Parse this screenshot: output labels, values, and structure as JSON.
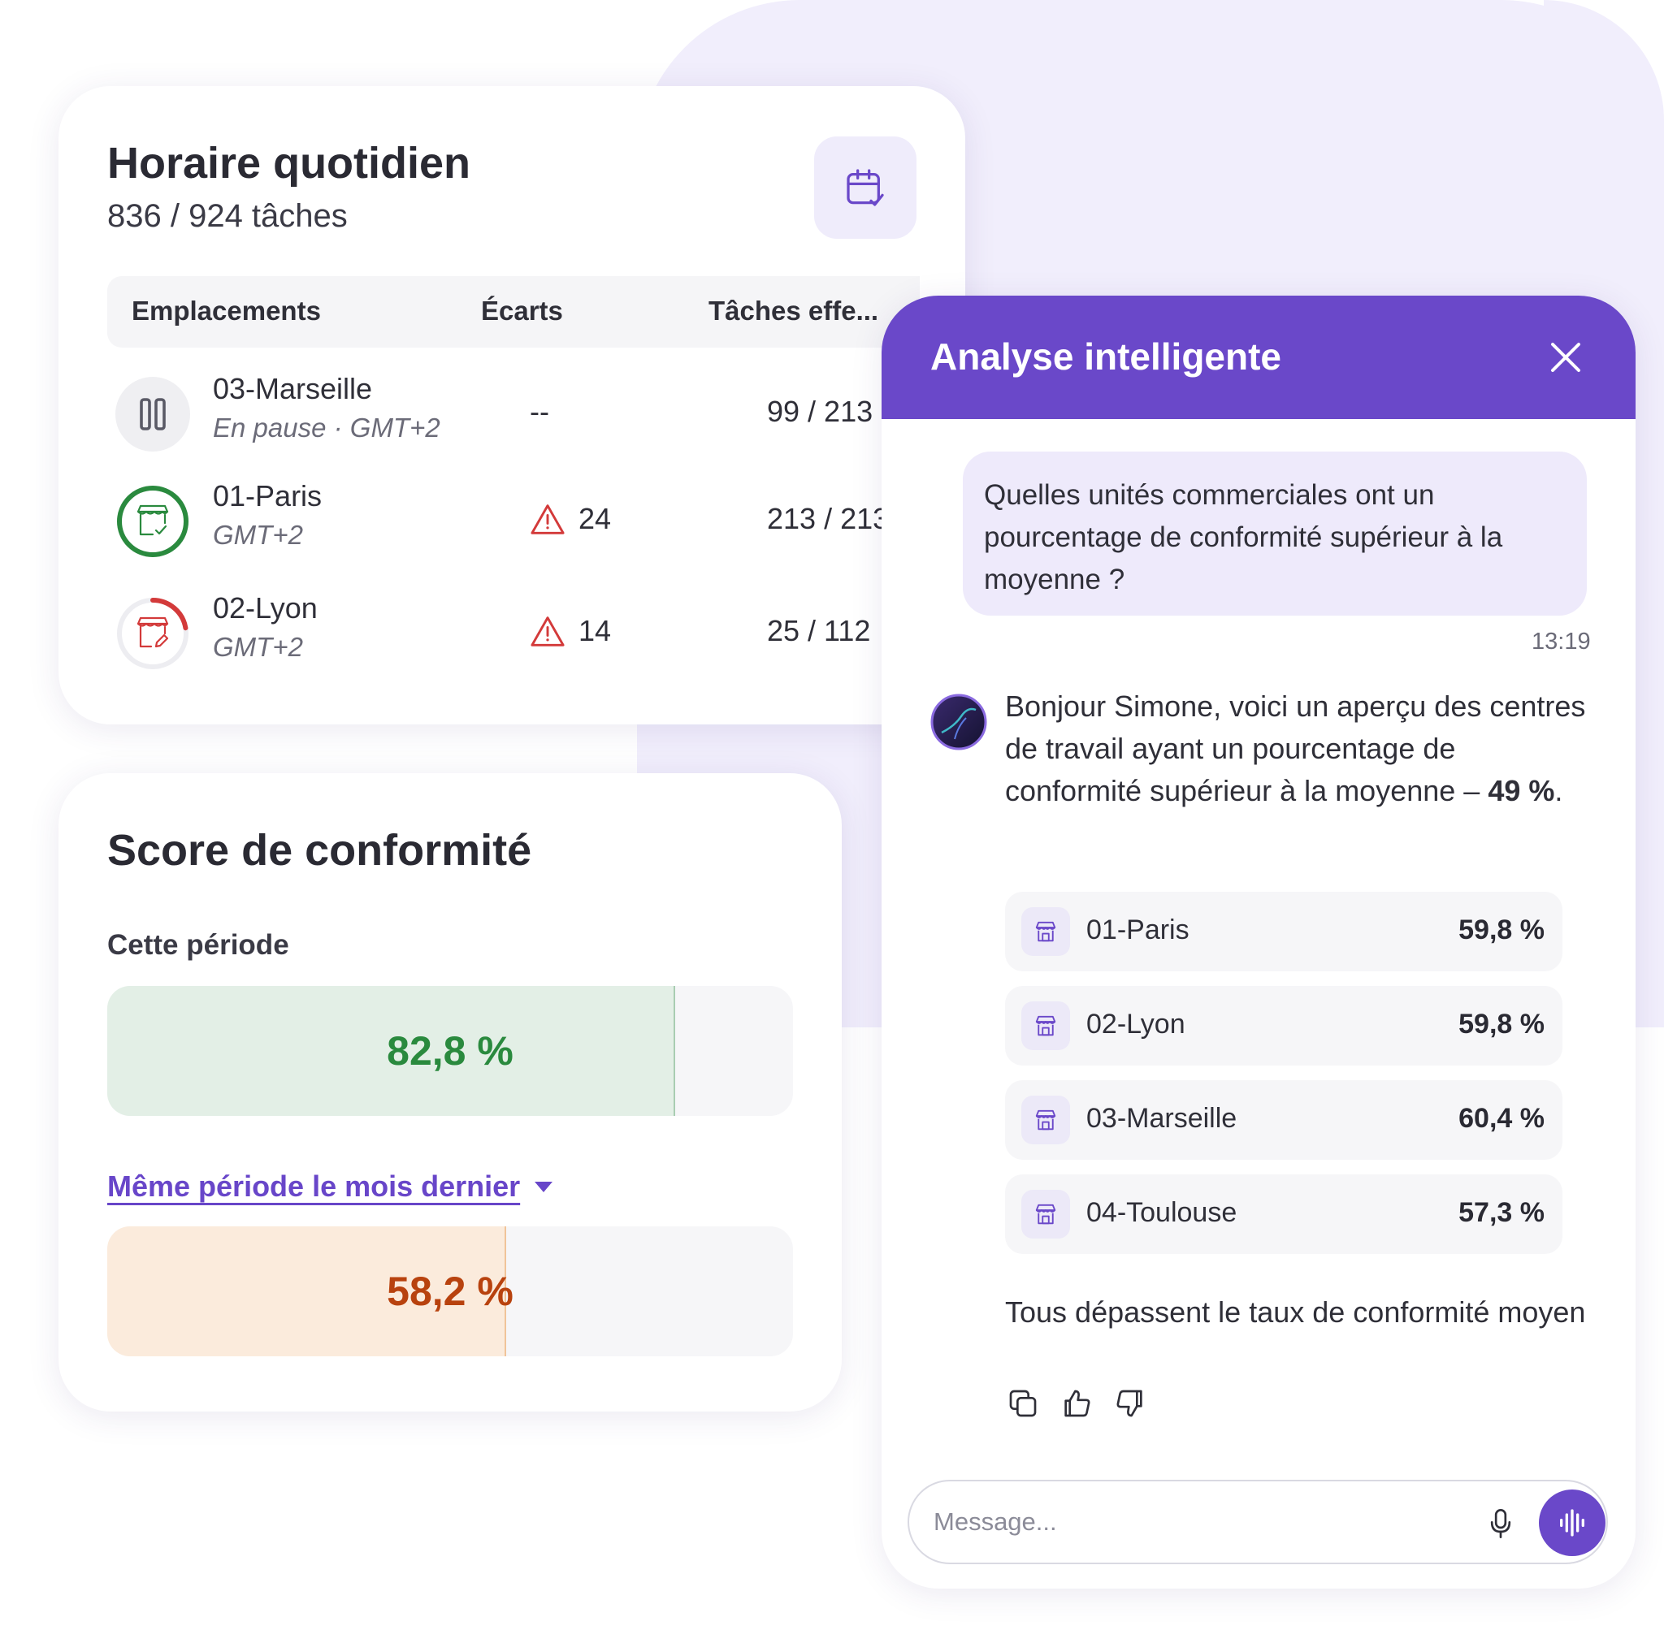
{
  "schedule": {
    "title": "Horaire quotidien",
    "subtitle": "836 / 924 tâches",
    "columns": [
      "Emplacements",
      "Écarts",
      "Tâches effe..."
    ],
    "rows": [
      {
        "name": "03-Marseille",
        "meta": "En pause · GMT+2",
        "deviations": "--",
        "tasks": "99 / 213",
        "status": "paused"
      },
      {
        "name": "01-Paris",
        "meta": "GMT+2",
        "deviations": "24",
        "tasks": "213 / 213",
        "status": "complete"
      },
      {
        "name": "02-Lyon",
        "meta": "GMT+2",
        "deviations": "14",
        "tasks": "25 / 112",
        "status": "in-progress"
      }
    ],
    "progress": {
      "paris": 1.0,
      "lyon": 0.223
    }
  },
  "compliance": {
    "title": "Score de conformité",
    "current_label": "Cette période",
    "current_value": "82,8 %",
    "current_fraction": 0.828,
    "previous_label": "Même période le mois dernier",
    "previous_value": "58,2 %",
    "previous_fraction": 0.582
  },
  "chat": {
    "title": "Analyse intelligente",
    "user_message": "Quelles unités commerciales ont un pourcentage de conformité supérieur à la moyenne ?",
    "user_time": "13:19",
    "bot_intro": "Bonjour Simone, voici un aperçu des centres de travail ayant un pourcentage de conformité supérieur à la moyenne – ",
    "bot_intro_bold": "49 %",
    "bot_intro_end": ".",
    "units": [
      {
        "name": "01-Paris",
        "pct": "59,8 %"
      },
      {
        "name": "02-Lyon",
        "pct": "59,8 %"
      },
      {
        "name": "03-Marseille",
        "pct": "60,4 %"
      },
      {
        "name": "04-Toulouse",
        "pct": "57,3 %"
      }
    ],
    "bot_footer": "Tous dépassent le taux de conformité moyen",
    "input_placeholder": "Message..."
  },
  "colors": {
    "accent": "#6a48c9",
    "green": "#2a8a3e",
    "red": "#d33a3a",
    "current_fill": "#e3efe6",
    "previous_fill": "#fbebdc",
    "previous_text": "#b8420e"
  },
  "icons": [
    "calendar-check-icon",
    "pause-icon",
    "store-check-icon",
    "store-edit-icon",
    "warning-icon",
    "close-icon",
    "store-icon",
    "copy-icon",
    "thumbs-up-icon",
    "thumbs-down-icon",
    "microphone-icon",
    "voice-wave-icon"
  ]
}
